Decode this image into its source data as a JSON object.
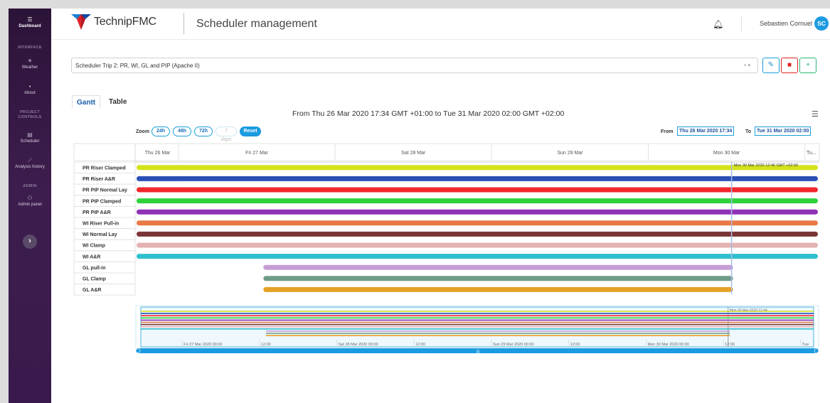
{
  "sidebar": {
    "dashboard": "Dashboard",
    "section_interface": "INTERFACE",
    "weather": "Weather",
    "about": "About",
    "section_project": [
      "PROJECT",
      "CONTROLS"
    ],
    "scheduler": "Scheduler",
    "analysis": "Analysis history",
    "section_admin": "ADMIN",
    "admin_panel": "Admin panel"
  },
  "header": {
    "brand": "TechnipFMC",
    "page_title": "Scheduler management",
    "user_name": "Sebastien Cornuel",
    "user_initials": "SC"
  },
  "scheduler_select": {
    "value": "Scheduler Trip 2: PR, WI, GL and PIP (Apache II)",
    "controls": "× ▾"
  },
  "tabs": [
    "Gantt",
    "Table"
  ],
  "gantt": {
    "range_title": "From Thu 26 Mar 2020 17:34 GMT +01:00 to Tue 31 Mar 2020 02:00 GMT +02:00",
    "zoom_label": "Zoom",
    "zoom_buttons": [
      "24h",
      "48h",
      "72h",
      "7 days",
      "Reset"
    ],
    "from_label": "From",
    "from_value": "Thu 26 Mar 2020 17:34",
    "to_label": "To",
    "to_value": "Tue 31 Mar 2020 02:00",
    "date_headers": [
      "Thu 26 Mar",
      "Fri 27 Mar",
      "Sat 28 Mar",
      "Sun 29 Mar",
      "Mon 30 Mar",
      "Tu..."
    ],
    "marker_label": "Mon 30 Mar 2020 12:46 GMT +02:00",
    "navigator_marker": "Mon 30 Mar 2020 12:44",
    "navigator_labels": [
      "Fri 27 Mar 2020 00:00",
      "12:00",
      "Sat 28 Mar 2020 00:00",
      "12:00",
      "Sun 29 Mar 2020 00:00",
      "12:00",
      "Mon 30 Mar 2020 00:00",
      "12:00",
      "Tue"
    ],
    "tasks": [
      {
        "name": "PR Riser Clamped",
        "color": "#d4e21a",
        "start": "Thu 26 Mar 17:34",
        "end": "Tue 31 Mar 02:00"
      },
      {
        "name": "PR Riser A&R",
        "color": "#2a4fb7",
        "start": "Thu 26 Mar 17:34",
        "end": "Tue 31 Mar 02:00"
      },
      {
        "name": "PR PIP Normal Lay",
        "color": "#f0282e",
        "start": "Thu 26 Mar 17:34",
        "end": "Tue 31 Mar 02:00"
      },
      {
        "name": "PR PIP Clamped",
        "color": "#2fd23a",
        "start": "Thu 26 Mar 17:34",
        "end": "Tue 31 Mar 02:00"
      },
      {
        "name": "PR PIP A&R",
        "color": "#8e32b8",
        "start": "Thu 26 Mar 17:34",
        "end": "Tue 31 Mar 02:00"
      },
      {
        "name": "WI Riser Pull-in",
        "color": "#ea7a45",
        "start": "Thu 26 Mar 17:34",
        "end": "Tue 31 Mar 02:00"
      },
      {
        "name": "WI Normal Lay",
        "color": "#7a3535",
        "start": "Thu 26 Mar 17:34",
        "end": "Tue 31 Mar 02:00"
      },
      {
        "name": "WI Clamp",
        "color": "#e4b2b2",
        "start": "Thu 26 Mar 17:34",
        "end": "Tue 31 Mar 02:00"
      },
      {
        "name": "WI A&R",
        "color": "#2fbfcc",
        "start": "Thu 26 Mar 17:34",
        "end": "Tue 31 Mar 02:00"
      },
      {
        "name": "GL pull-in",
        "color": "#c59ed6",
        "start": "Fri 27 Mar 13:00",
        "end": "Mon 30 Mar 13:00"
      },
      {
        "name": "GL Clamp",
        "color": "#6e9c88",
        "start": "Fri 27 Mar 13:00",
        "end": "Mon 30 Mar 13:00"
      },
      {
        "name": "GL A&R",
        "color": "#e5a126",
        "start": "Fri 27 Mar 13:00",
        "end": "Mon 30 Mar 13:00"
      }
    ]
  },
  "colors": {
    "accent": "#19a0d8",
    "sidebar": "#3a1a4c",
    "delete": "#e02020",
    "add": "#2bb673"
  }
}
